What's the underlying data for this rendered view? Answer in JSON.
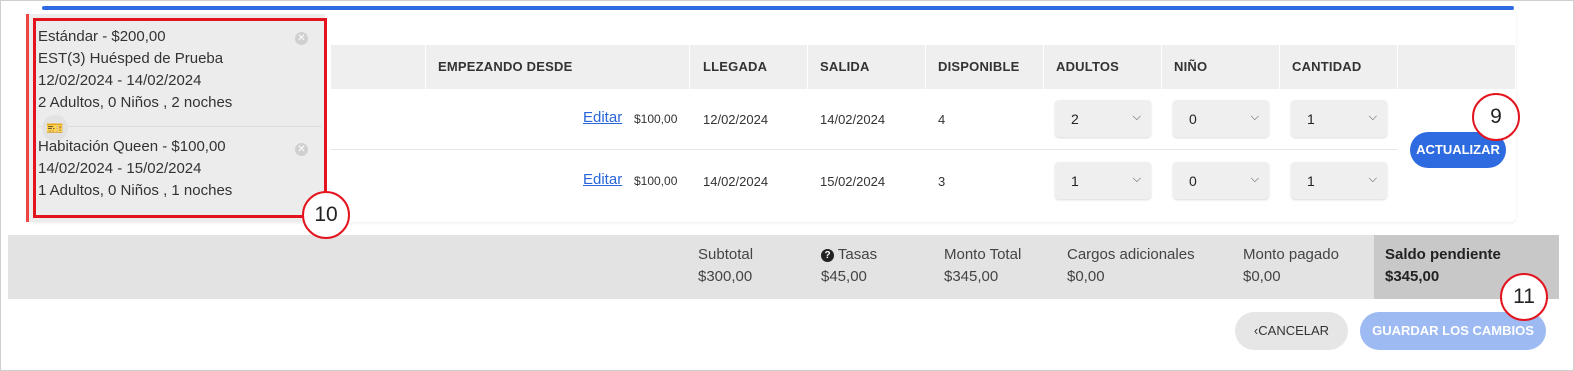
{
  "table": {
    "headers": {
      "starting_from": "EMPEZANDO DESDE",
      "arrival": "LLEGADA",
      "departure": "SALIDA",
      "available": "DISPONIBLE",
      "adults": "ADULTOS",
      "child": "NIÑO",
      "quantity": "CANTIDAD"
    },
    "rows": [
      {
        "edit": "Editar",
        "price": "$100,00",
        "arrival": "12/02/2024",
        "departure": "14/02/2024",
        "available": "4",
        "adults": "2",
        "child": "0",
        "quantity": "1"
      },
      {
        "edit": "Editar",
        "price": "$100,00",
        "arrival": "14/02/2024",
        "departure": "15/02/2024",
        "available": "3",
        "adults": "1",
        "child": "0",
        "quantity": "1"
      }
    ],
    "update_button": "ACTUALIZAR"
  },
  "bundles": [
    {
      "line1": "Estándar - $200,00",
      "line2": "EST(3) Huésped de Prueba",
      "line3": "12/02/2024 - 14/02/2024",
      "line4": "2 Adultos, 0 Niños , 2 noches"
    },
    {
      "line1": "Habitación Queen - $100,00",
      "line2": "14/02/2024 - 15/02/2024",
      "line3": "1 Adultos, 0 Niños , 1 noches"
    }
  ],
  "totals": {
    "subtotal_label": "Subtotal",
    "subtotal": "$300,00",
    "taxes_label": "Tasas",
    "taxes": "$45,00",
    "total_label": "Monto Total",
    "total": "$345,00",
    "extra_label": "Cargos adicionales",
    "extra": "$0,00",
    "paid_label": "Monto pagado",
    "paid": "$0,00",
    "balance_label": "Saldo pendiente",
    "balance": "$345,00"
  },
  "footer": {
    "cancel": "CANCELAR",
    "save": "GUARDAR LOS CAMBIOS"
  },
  "callouts": {
    "c9": "9",
    "c10": "10",
    "c11": "11"
  },
  "icons": {
    "select_chevron": "chevron-down-icon",
    "remove": "close-circle-icon",
    "ticket": "ticket-icon",
    "help": "question-circle-icon",
    "back": "chevron-left-icon"
  },
  "colors": {
    "accent": "#2f6be0",
    "callout": "#e3141e",
    "save_disabled": "#9dbaf3"
  }
}
